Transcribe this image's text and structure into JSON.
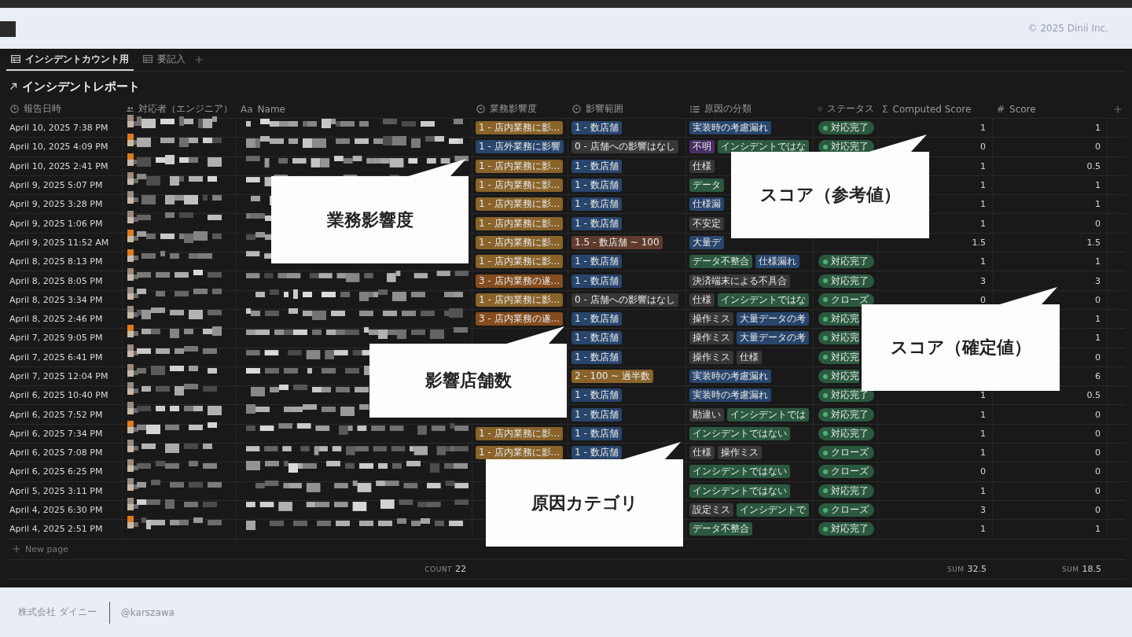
{
  "header": {
    "copyright": "© 2025 Dinii Inc."
  },
  "tabs": [
    {
      "label": "インシデントカウント用",
      "selected": true
    },
    {
      "label": "要記入",
      "selected": false
    }
  ],
  "title": "インシデントレポート",
  "columns": [
    {
      "label": "報告日時",
      "kind": "date"
    },
    {
      "label": "対応者（エンジニア）",
      "kind": "person"
    },
    {
      "label": "Name",
      "kind": "title",
      "icon_text": "Aa"
    },
    {
      "label": "業務影響度",
      "kind": "impact"
    },
    {
      "label": "影響範囲",
      "kind": "scope"
    },
    {
      "label": "原因の分類",
      "kind": "causes"
    },
    {
      "label": "ステータス",
      "kind": "status"
    },
    {
      "label": "Computed Score",
      "kind": "computed",
      "icon_text": "Σ"
    },
    {
      "label": "Score",
      "kind": "score",
      "icon_text": "#"
    }
  ],
  "rows": [
    {
      "date": "April 10, 2025 7:38 PM",
      "impact": {
        "label": "1 - 店内業務に影...",
        "color": "#89632a"
      },
      "scope": {
        "label": "1 - 数店舗",
        "color": "#28456c"
      },
      "causes": [
        {
          "label": "実装時の考慮漏れ",
          "color": "#28456c"
        }
      ],
      "status": "対応完了",
      "computed": "1",
      "score": "1"
    },
    {
      "date": "April 10, 2025 4:09 PM",
      "impact": {
        "label": "1 - 店外業務に影響",
        "color": "#28456c"
      },
      "scope": {
        "label": "0 - 店舗への影響はなし",
        "color": "#373737"
      },
      "causes": [
        {
          "label": "不明",
          "color": "#492f64"
        },
        {
          "label": "インシデントではな",
          "color": "#2b593f"
        }
      ],
      "status": "対応完了",
      "computed": "0",
      "score": "0"
    },
    {
      "date": "April 10, 2025 2:41 PM",
      "impact": {
        "label": "1 - 店内業務に影...",
        "color": "#89632a"
      },
      "scope": {
        "label": "1 - 数店舗",
        "color": "#28456c"
      },
      "causes": [
        {
          "label": "仕様",
          "color": "#373737"
        }
      ],
      "status": null,
      "computed": "1",
      "score": "0.5"
    },
    {
      "date": "April 9, 2025 5:07 PM",
      "impact": {
        "label": "1 - 店内業務に影...",
        "color": "#89632a"
      },
      "scope": {
        "label": "1 - 数店舗",
        "color": "#28456c"
      },
      "causes": [
        {
          "label": "データ",
          "color": "#2b593f"
        }
      ],
      "status": null,
      "computed": "1",
      "score": "1"
    },
    {
      "date": "April 9, 2025 3:28 PM",
      "impact": {
        "label": "1 - 店内業務に影...",
        "color": "#89632a"
      },
      "scope": {
        "label": "1 - 数店舗",
        "color": "#28456c"
      },
      "causes": [
        {
          "label": "仕様漏",
          "color": "#28456c"
        }
      ],
      "status": null,
      "computed": "1",
      "score": "1"
    },
    {
      "date": "April 9, 2025 1:06 PM",
      "impact": {
        "label": "1 - 店内業務に影...",
        "color": "#89632a"
      },
      "scope": {
        "label": "1 - 数店舗",
        "color": "#28456c"
      },
      "causes": [
        {
          "label": "不安定",
          "color": "#373737"
        }
      ],
      "status": null,
      "computed": "1",
      "score": "0"
    },
    {
      "date": "April 9, 2025 11:52 AM",
      "impact": {
        "label": "1 - 店内業務に影...",
        "color": "#89632a"
      },
      "scope": {
        "label": "1.5 - 数店舗 ~ 100",
        "color": "#603b2c"
      },
      "causes": [
        {
          "label": "大量デ",
          "color": "#28456c"
        }
      ],
      "status": null,
      "computed": "1.5",
      "score": "1.5"
    },
    {
      "date": "April 8, 2025 8:13 PM",
      "impact": {
        "label": "1 - 店内業務に影...",
        "color": "#89632a"
      },
      "scope": {
        "label": "1 - 数店舗",
        "color": "#28456c"
      },
      "causes": [
        {
          "label": "データ不整合",
          "color": "#2b593f"
        },
        {
          "label": "仕様漏れ",
          "color": "#28456c"
        }
      ],
      "status": "対応完了",
      "computed": "1",
      "score": "1"
    },
    {
      "date": "April 8, 2025 8:05 PM",
      "impact": {
        "label": "3 - 店内業務の遂...",
        "color": "#854c1d"
      },
      "scope": {
        "label": "1 - 数店舗",
        "color": "#28456c"
      },
      "causes": [
        {
          "label": "決済端末による不具合",
          "color": "#373737"
        }
      ],
      "status": "対応完了",
      "computed": "3",
      "score": "3"
    },
    {
      "date": "April 8, 2025 3:34 PM",
      "impact": {
        "label": "1 - 店内業務に影...",
        "color": "#89632a"
      },
      "scope": {
        "label": "0 - 店舗への影響はなし",
        "color": "#373737"
      },
      "causes": [
        {
          "label": "仕様",
          "color": "#373737"
        },
        {
          "label": "インシデントではな",
          "color": "#2b593f"
        }
      ],
      "status": "クローズ",
      "computed": "0",
      "score": "0"
    },
    {
      "date": "April 8, 2025 2:46 PM",
      "impact": {
        "label": "3 - 店内業務の遂...",
        "color": "#854c1d"
      },
      "scope": {
        "label": "1 - 数店舗",
        "color": "#28456c"
      },
      "causes": [
        {
          "label": "操作ミス",
          "color": "#373737"
        },
        {
          "label": "大量データの考",
          "color": "#28456c"
        }
      ],
      "status": "対応完",
      "computed": null,
      "score": "1"
    },
    {
      "date": "April 7, 2025 9:05 PM",
      "impact": null,
      "scope": {
        "label": "1 - 数店舗",
        "color": "#28456c"
      },
      "causes": [
        {
          "label": "操作ミス",
          "color": "#373737"
        },
        {
          "label": "大量データの考",
          "color": "#28456c"
        }
      ],
      "status": "対応完",
      "computed": null,
      "score": "1"
    },
    {
      "date": "April 7, 2025 6:41 PM",
      "impact": null,
      "scope": {
        "label": "1 - 数店舗",
        "color": "#28456c"
      },
      "causes": [
        {
          "label": "操作ミス",
          "color": "#373737"
        },
        {
          "label": "仕様",
          "color": "#373737"
        }
      ],
      "status": "対応完",
      "computed": null,
      "score": "0"
    },
    {
      "date": "April 7, 2025 12:04 PM",
      "impact": null,
      "scope": {
        "label": "2 - 100 ~ 過半数",
        "color": "#89632a"
      },
      "causes": [
        {
          "label": "実装時の考慮漏れ",
          "color": "#28456c"
        }
      ],
      "status": "対応完",
      "computed": null,
      "score": "6"
    },
    {
      "date": "April 6, 2025 10:40 PM",
      "impact": null,
      "scope": {
        "label": "1 - 数店舗",
        "color": "#28456c"
      },
      "causes": [
        {
          "label": "実装時の考慮漏れ",
          "color": "#28456c"
        }
      ],
      "status": "対応完了",
      "computed": "1",
      "score": "0.5"
    },
    {
      "date": "April 6, 2025 7:52 PM",
      "impact": null,
      "scope": {
        "label": "1 - 数店舗",
        "color": "#28456c"
      },
      "causes": [
        {
          "label": "勘違い",
          "color": "#373737"
        },
        {
          "label": "インシデントでは",
          "color": "#2b593f"
        }
      ],
      "status": "対応完了",
      "computed": "1",
      "score": "0"
    },
    {
      "date": "April 6, 2025 7:34 PM",
      "impact": {
        "label": "1 - 店内業務に影...",
        "color": "#89632a"
      },
      "scope": {
        "label": "1 - 数店舗",
        "color": "#28456c"
      },
      "causes": [
        {
          "label": "インシデントではない",
          "color": "#2b593f"
        }
      ],
      "status": "対応完了",
      "computed": "1",
      "score": "0"
    },
    {
      "date": "April 6, 2025 7:08 PM",
      "impact": {
        "label": "1 - 店内業務に影...",
        "color": "#89632a"
      },
      "scope": {
        "label": "1 - 数店舗",
        "color": "#28456c"
      },
      "causes": [
        {
          "label": "仕様",
          "color": "#373737"
        },
        {
          "label": "操作ミス",
          "color": "#373737"
        }
      ],
      "status": "クローズ",
      "computed": "1",
      "score": "0"
    },
    {
      "date": "April 6, 2025 6:25 PM",
      "impact": null,
      "scope": null,
      "causes": [
        {
          "label": "インシデントではない",
          "color": "#2b593f"
        }
      ],
      "status": "クローズ",
      "computed": "0",
      "score": "0"
    },
    {
      "date": "April 5, 2025 3:11 PM",
      "impact": null,
      "scope": null,
      "causes": [
        {
          "label": "インシデントではない",
          "color": "#2b593f"
        }
      ],
      "status": "対応完了",
      "computed": "1",
      "score": "0"
    },
    {
      "date": "April 4, 2025 6:30 PM",
      "impact": null,
      "scope": null,
      "causes": [
        {
          "label": "設定ミス",
          "color": "#373737"
        },
        {
          "label": "インシデントで",
          "color": "#2b593f"
        }
      ],
      "status": "クローズ",
      "computed": "3",
      "score": "0"
    },
    {
      "date": "April 4, 2025 2:51 PM",
      "impact": null,
      "scope": null,
      "causes": [
        {
          "label": "データ不整合",
          "color": "#2b593f"
        }
      ],
      "status": "対応完了",
      "computed": "1",
      "score": "1"
    }
  ],
  "new_page": "New page",
  "totals": {
    "count": {
      "label": "COUNT",
      "value": "22"
    },
    "computed_sum": {
      "label": "SUM",
      "value": "32.5"
    },
    "score_sum": {
      "label": "SUM",
      "value": "18.5"
    }
  },
  "callouts": [
    {
      "text": "業務影響度"
    },
    {
      "text": "スコア（参考値）"
    },
    {
      "text": "スコア（確定値）"
    },
    {
      "text": "影響店舗数"
    },
    {
      "text": "原因カテゴリ"
    }
  ],
  "footer": {
    "company": "株式会社 ダイニー",
    "handle": "@karszawa"
  }
}
